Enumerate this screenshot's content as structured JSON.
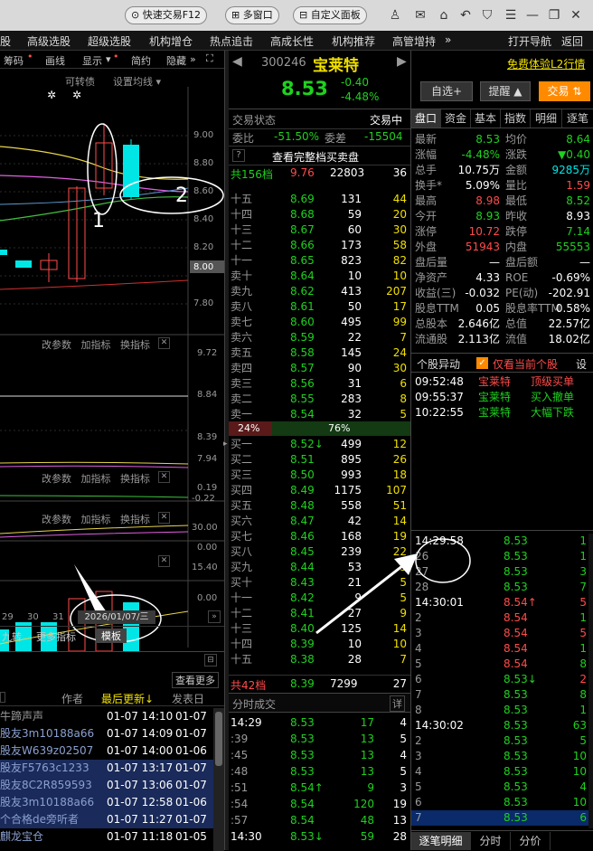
{
  "topbar": {
    "quick": "快速交易F12",
    "multi": "多窗口",
    "custom": "自定义面板",
    "more": "…"
  },
  "menu": [
    "股",
    "高级选股",
    "超级选股",
    "机构增仓",
    "热点追击",
    "高成长性",
    "机构推荐",
    "高管增持",
    "»",
    "打开导航",
    "返回"
  ],
  "chart_toolbar": [
    "筹码",
    "画线",
    "显示",
    "简约",
    "隐藏"
  ],
  "kline": {
    "label1": "可转债",
    "label2": "设置均线",
    "prices": [
      "9.00",
      "8.80",
      "8.60",
      "8.40",
      "8.20",
      "8.00",
      "7.80"
    ],
    "anno1": "1",
    "anno2": "2"
  },
  "ind1": {
    "btns": [
      "改参数",
      "加指标",
      "换指标"
    ],
    "vals": [
      "9.72",
      "8.84",
      "8.39",
      "7.94"
    ]
  },
  "ind2": {
    "btns": [
      "改参数",
      "加指标",
      "换指标"
    ],
    "vals": [
      "0.19",
      "-0.22"
    ]
  },
  "ind3": {
    "btns": [
      "改参数",
      "加指标",
      "换指标"
    ],
    "vals": [
      "30.00",
      "0.00"
    ]
  },
  "ind4": {
    "vals": [
      "15.40",
      "0.00"
    ]
  },
  "xaxis": {
    "d1": "29",
    "d2": "30",
    "d3": "31",
    "date": "2026/01/07/三"
  },
  "bottom_tabs": {
    "t1": "九转",
    "t2": "更多指标",
    "t3": "模板"
  },
  "news": {
    "more": "查看更多",
    "h_author": "作者",
    "h_updated": "最后更新↓",
    "h_post": "发表日",
    "rows": [
      {
        "author": "牛蹄声声",
        "upd": "",
        "post": ""
      },
      {
        "author": "股友3m10188a66",
        "upd": "01-07 14:09",
        "post": "01-07"
      },
      {
        "author": "股友W639z02507",
        "upd": "01-07 14:00",
        "post": "01-06"
      },
      {
        "author": "股友F5763c1233",
        "upd": "01-07 13:17",
        "post": "01-07"
      },
      {
        "author": "股友8C2R859593",
        "upd": "01-07 13:06",
        "post": "01-07"
      },
      {
        "author": "股友3m10188a66",
        "upd": "01-07 12:58",
        "post": "01-06"
      },
      {
        "author": "个合格de旁听者",
        "upd": "01-07 11:27",
        "post": "01-07"
      },
      {
        "author": "麒龙宝仓",
        "upd": "01-07 11:18",
        "post": "01-05"
      }
    ],
    "first_upd": "01-07 14:10",
    "first_post": "01-07"
  },
  "stock": {
    "code": "300246",
    "name": "宝莱特",
    "price": "8.53",
    "chg": "-0.40",
    "pct": "-4.48%",
    "free": "免费体验L2行情",
    "btn_watch": "自选+",
    "btn_alert": "提醒",
    "btn_trade": "交易"
  },
  "trade_state": {
    "label": "交易状态",
    "value": "交易中",
    "wb_label": "委比",
    "wb": "-51.50%",
    "wc_label": "委差",
    "wc": "-15504",
    "full": "查看完整档买卖盘",
    "total_label": "共156档",
    "total_price": "9.76",
    "total_vol": "22803",
    "total_n": "36"
  },
  "asks": [
    {
      "l": "十五",
      "p": "8.69",
      "v": "131",
      "n": "44"
    },
    {
      "l": "十四",
      "p": "8.68",
      "v": "59",
      "n": "20"
    },
    {
      "l": "十三",
      "p": "8.67",
      "v": "60",
      "n": "30"
    },
    {
      "l": "十二",
      "p": "8.66",
      "v": "173",
      "n": "58"
    },
    {
      "l": "十一",
      "p": "8.65",
      "v": "823",
      "n": "82"
    },
    {
      "l": "卖十",
      "p": "8.64",
      "v": "10",
      "n": "10"
    },
    {
      "l": "卖九",
      "p": "8.62",
      "v": "413",
      "n": "207"
    },
    {
      "l": "卖八",
      "p": "8.61",
      "v": "50",
      "n": "17"
    },
    {
      "l": "卖七",
      "p": "8.60",
      "v": "495",
      "n": "99"
    },
    {
      "l": "卖六",
      "p": "8.59",
      "v": "22",
      "n": "7"
    },
    {
      "l": "卖五",
      "p": "8.58",
      "v": "145",
      "n": "24"
    },
    {
      "l": "卖四",
      "p": "8.57",
      "v": "90",
      "n": "30"
    },
    {
      "l": "卖三",
      "p": "8.56",
      "v": "31",
      "n": "6"
    },
    {
      "l": "卖二",
      "p": "8.55",
      "v": "283",
      "n": "8"
    },
    {
      "l": "卖一",
      "p": "8.54",
      "v": "32",
      "n": "5"
    }
  ],
  "ratio": {
    "left": "24%",
    "right": "76%"
  },
  "bids": [
    {
      "l": "买一",
      "p": "8.52↓",
      "v": "499",
      "n": "12"
    },
    {
      "l": "买二",
      "p": "8.51",
      "v": "895",
      "n": "26"
    },
    {
      "l": "买三",
      "p": "8.50",
      "v": "993",
      "n": "18"
    },
    {
      "l": "买四",
      "p": "8.49",
      "v": "1175",
      "n": "107"
    },
    {
      "l": "买五",
      "p": "8.48",
      "v": "558",
      "n": "51"
    },
    {
      "l": "买六",
      "p": "8.47",
      "v": "42",
      "n": "14"
    },
    {
      "l": "买七",
      "p": "8.46",
      "v": "168",
      "n": "19"
    },
    {
      "l": "买八",
      "p": "8.45",
      "v": "239",
      "n": "22"
    },
    {
      "l": "买九",
      "p": "8.44",
      "v": "53",
      "n": "5"
    },
    {
      "l": "买十",
      "p": "8.43",
      "v": "21",
      "n": "5"
    },
    {
      "l": "十一",
      "p": "8.42",
      "v": "9",
      "n": "5"
    },
    {
      "l": "十二",
      "p": "8.41",
      "v": "27",
      "n": "9"
    },
    {
      "l": "十三",
      "p": "8.40",
      "v": "125",
      "n": "14"
    },
    {
      "l": "十四",
      "p": "8.39",
      "v": "10",
      "n": "10"
    },
    {
      "l": "十五",
      "p": "8.38",
      "v": "28",
      "n": "7"
    }
  ],
  "bid_total": {
    "label": "共42档",
    "price": "8.39",
    "vol": "7299",
    "n": "27"
  },
  "ticks_title": "分时成交",
  "ticks_detail": "详",
  "ticks": [
    {
      "t": "14:29",
      "p": "8.53",
      "v": "17",
      "n": "4"
    },
    {
      "t": ":39",
      "p": "8.53",
      "v": "13",
      "n": "5"
    },
    {
      "t": ":45",
      "p": "8.53",
      "v": "13",
      "n": "4"
    },
    {
      "t": ":48",
      "p": "8.53",
      "v": "13",
      "n": "5"
    },
    {
      "t": ":51",
      "p": "8.54↑",
      "v": "9",
      "n": "3"
    },
    {
      "t": ":54",
      "p": "8.54",
      "v": "120",
      "n": "19"
    },
    {
      "t": ":57",
      "p": "8.54",
      "v": "48",
      "n": "13"
    },
    {
      "t": "14:30",
      "p": "8.53↓",
      "v": "59",
      "n": "28"
    }
  ],
  "tabs": [
    "盘口",
    "资金",
    "基本",
    "指数",
    "明细",
    "逐笔"
  ],
  "quote": [
    [
      "最新",
      "8.53",
      "均价",
      "8.64"
    ],
    [
      "涨幅",
      "-4.48%",
      "涨跌",
      "▼0.40"
    ],
    [
      "总手",
      "10.75万",
      "金额",
      "9285万"
    ],
    [
      "换手*",
      "5.09%",
      "量比",
      "1.59"
    ],
    [
      "最高",
      "8.98",
      "最低",
      "8.52"
    ],
    [
      "今开",
      "8.93",
      "昨收",
      "8.93"
    ],
    [
      "涨停",
      "10.72",
      "跌停",
      "7.14"
    ],
    [
      "外盘",
      "51943",
      "内盘",
      "55553"
    ],
    [
      "盘后量",
      "—",
      "盘后额",
      "—"
    ],
    [
      "净资产",
      "4.33",
      "ROE",
      "-0.69%"
    ],
    [
      "收益(三)",
      "-0.032",
      "PE(动)",
      "-202.91"
    ],
    [
      "股息TTM",
      "0.05",
      "股息率TTM",
      "0.58%"
    ],
    [
      "总股本",
      "2.646亿",
      "总值",
      "22.57亿"
    ],
    [
      "流通股",
      "2.113亿",
      "流值",
      "18.02亿"
    ]
  ],
  "movers": {
    "title": "个股异动",
    "only": "仅看当前个股",
    "set": "设",
    "rows": [
      {
        "t": "09:52:48",
        "n": "宝莱特",
        "e": "顶级买单"
      },
      {
        "t": "09:55:37",
        "n": "宝莱特",
        "e": "买入撤单"
      },
      {
        "t": "10:22:55",
        "n": "宝莱特",
        "e": "大幅下跌"
      }
    ]
  },
  "detail": [
    {
      "t": "14:29:58",
      "p": "8.53",
      "v": "1"
    },
    {
      "t": "26",
      "p": "8.53",
      "v": "1"
    },
    {
      "t": "27",
      "p": "8.53",
      "v": "3"
    },
    {
      "t": "28",
      "p": "8.53",
      "v": "7"
    },
    {
      "t": "14:30:01",
      "p": "8.54↑",
      "v": "5"
    },
    {
      "t": "2",
      "p": "8.54",
      "v": "1"
    },
    {
      "t": "3",
      "p": "8.54",
      "v": "5"
    },
    {
      "t": "4",
      "p": "8.54",
      "v": "1"
    },
    {
      "t": "5",
      "p": "8.54",
      "v": "8"
    },
    {
      "t": "6",
      "p": "8.53↓",
      "v": "2"
    },
    {
      "t": "7",
      "p": "8.53",
      "v": "8"
    },
    {
      "t": "8",
      "p": "8.53",
      "v": "1"
    },
    {
      "t": "14:30:02",
      "p": "8.53",
      "v": "63"
    },
    {
      "t": "2",
      "p": "8.53",
      "v": "5"
    },
    {
      "t": "3",
      "p": "8.53",
      "v": "10"
    },
    {
      "t": "4",
      "p": "8.53",
      "v": "10"
    },
    {
      "t": "5",
      "p": "8.53",
      "v": "4"
    },
    {
      "t": "6",
      "p": "8.53",
      "v": "10"
    },
    {
      "t": "7",
      "p": "8.53",
      "v": "6"
    }
  ],
  "bottom_right_tabs": [
    "逐笔明细",
    "分时",
    "分价"
  ]
}
